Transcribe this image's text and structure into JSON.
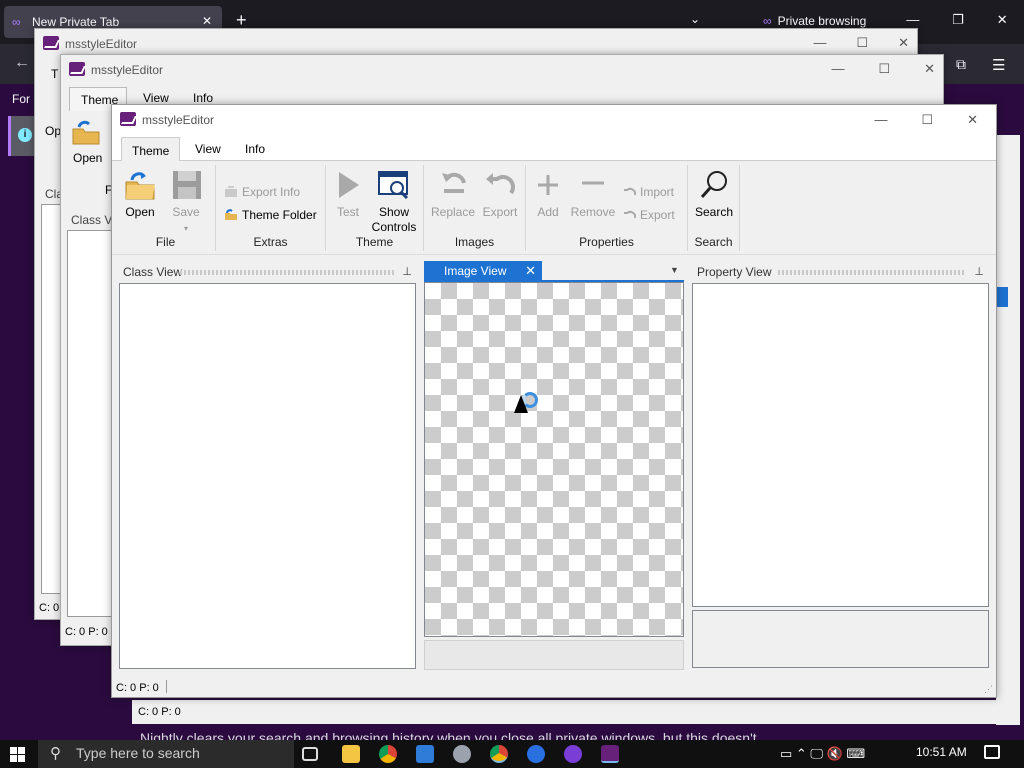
{
  "firefox": {
    "tab_title": "New Private Tab",
    "tab_close": "✕",
    "new_tab": "+",
    "list_all_tabs": "⌄",
    "private_label": "Private browsing",
    "window_controls": [
      "—",
      "❐",
      "✕"
    ],
    "for_text": "For",
    "footer_text": "Nightly clears your search and browsing history when you close all private windows, but this doesn't"
  },
  "back_windows": {
    "title": "msstyleEditor",
    "w1_open_label": "Op",
    "w1_class_label": "Cla",
    "w1_status": "C: 0",
    "w1_tab_label": "T",
    "w2_tabs": [
      "Theme",
      "View",
      "Info"
    ],
    "w2_open_label": "Open",
    "w2_file_label": "Fi",
    "w2_class_label": "Class Vi",
    "w2_status": "C: 0 P: 0",
    "w3_status": "C: 0 P: 0"
  },
  "main": {
    "title": "msstyleEditor",
    "window_controls": [
      "—",
      "☐",
      "✕"
    ],
    "tabs": [
      {
        "label": "Theme",
        "selected": true
      },
      {
        "label": "View",
        "selected": false
      },
      {
        "label": "Info",
        "selected": false
      }
    ],
    "ribbon": {
      "file": {
        "label": "File",
        "open": "Open",
        "save": "Save",
        "save_arrow": "▾"
      },
      "extras": {
        "label": "Extras",
        "export_info": "Export Info",
        "theme_folder": "Theme Folder"
      },
      "theme": {
        "label": "Theme",
        "test": "Test",
        "show_controls_1": "Show",
        "show_controls_2": "Controls"
      },
      "images": {
        "label": "Images",
        "replace": "Replace",
        "export": "Export"
      },
      "properties": {
        "label": "Properties",
        "add": "Add",
        "remove": "Remove",
        "import": "Import",
        "export": "Export"
      },
      "search": {
        "label": "Search",
        "search": "Search"
      }
    },
    "class_view": {
      "title": "Class View",
      "pin": "📌"
    },
    "image_view": {
      "tab": "Image View",
      "close": "✕",
      "dropdown": "▼"
    },
    "property_view": {
      "title": "Property View",
      "pin": "📌"
    },
    "status": "C: 0 P: 0"
  },
  "taskbar": {
    "search_placeholder": "Type here to search",
    "time": "10:51 AM",
    "tray": "▭  ⌃  🖵  🔇  ⌨"
  },
  "colors": {
    "accent": "#1e73d2",
    "firefox_bg": "#2b0b3f",
    "private_purple": "#b47bff",
    "taskbar": "#101010"
  }
}
